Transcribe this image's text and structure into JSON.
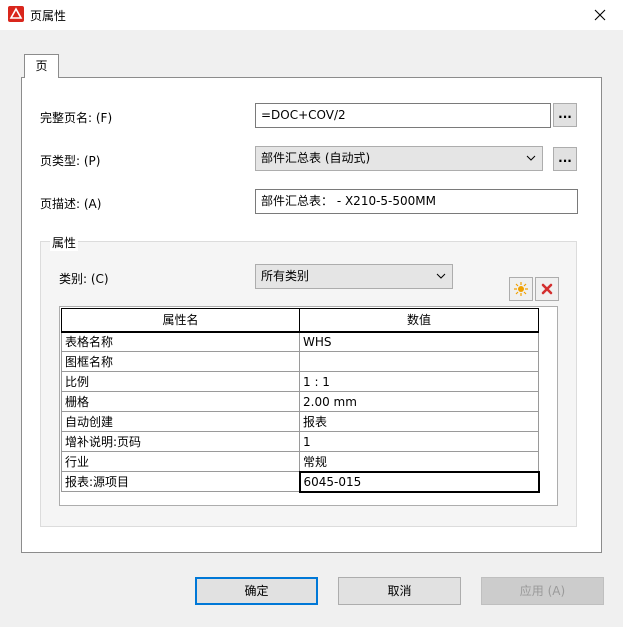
{
  "window": {
    "title": "页属性",
    "close_icon": "close-icon"
  },
  "tabs": [
    {
      "label": "页"
    }
  ],
  "fields": {
    "full_name": {
      "label": "完整页名: (F)",
      "value": "=DOC+COV/2",
      "button": "..."
    },
    "page_type": {
      "label": "页类型: (P)",
      "value": "部件汇总表 (自动式)",
      "button": "..."
    },
    "description": {
      "label": "页描述: (A)",
      "value": "部件汇总表： - X210-5-500MM"
    }
  },
  "properties": {
    "group_title": "属性",
    "category_label": "类别: (C)",
    "category_value": "所有类别",
    "columns": [
      "属性名",
      "数值"
    ],
    "rows": [
      [
        "表格名称",
        "WHS"
      ],
      [
        "图框名称",
        ""
      ],
      [
        "比例",
        "1 : 1"
      ],
      [
        "栅格",
        "2.00 mm"
      ],
      [
        "自动创建",
        "报表"
      ],
      [
        "增补说明:页码",
        "1"
      ],
      [
        "行业",
        "常规"
      ],
      [
        "报表:源项目",
        "6045-015"
      ]
    ]
  },
  "buttons": {
    "ok": "确定",
    "cancel": "取消",
    "apply": "应用 (A)"
  },
  "colors": {
    "accent": "#0078d7",
    "delete": "#d32f2f",
    "new": "#f0a000"
  }
}
